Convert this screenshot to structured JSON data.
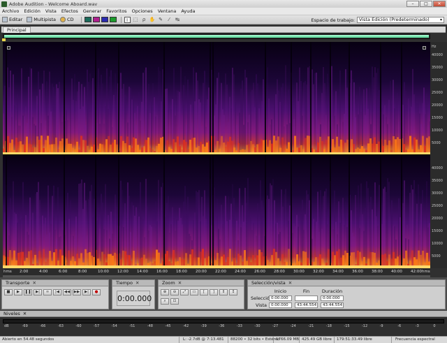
{
  "window": {
    "title": "Adobe Audition - Welcome Aboard.wav"
  },
  "menu": [
    "Archivo",
    "Edición",
    "Vista",
    "Efectos",
    "Generar",
    "Favoritos",
    "Opciones",
    "Ventana",
    "Ayuda"
  ],
  "toolbar": {
    "edit_label": "Editar",
    "multitrack_label": "Multipista",
    "cd_label": "CD",
    "workspace_label": "Espacio de trabajo:",
    "workspace_value": "Vista Edición (Predeterminado)"
  },
  "main_panel": {
    "tab": "Principal"
  },
  "spectrogram": {
    "hz_labels": [
      "Hz",
      "40000",
      "35000",
      "30000",
      "25000",
      "20000",
      "15000",
      "10000",
      "5000",
      "40000",
      "35000",
      "30000",
      "25000",
      "20000",
      "15000",
      "10000",
      "5000"
    ],
    "time_labels": [
      "hms",
      "2:00",
      "4:00",
      "6:00",
      "8:00",
      "10:00",
      "12:00",
      "14:00",
      "16:00",
      "18:00",
      "20:00",
      "22:00",
      "24:00",
      "26:00",
      "28:00",
      "30:00",
      "32:00",
      "34:00",
      "36:00",
      "38:00",
      "40:00",
      "42:00",
      "hms"
    ]
  },
  "transport": {
    "title": "Transporte"
  },
  "time": {
    "title": "Tiempo",
    "value": "0:00.000"
  },
  "zoom": {
    "title": "Zoom"
  },
  "selection": {
    "title": "Selección/vista",
    "headers": [
      "Inicio",
      "Fin",
      "Duración"
    ],
    "rows": [
      {
        "label": "Selección",
        "start": "0:00.000",
        "end": "",
        "duration": "0:00.000"
      },
      {
        "label": "Vista",
        "start": "0:00.000",
        "end": "43:44.554",
        "duration": "43:44.554"
      }
    ]
  },
  "levels": {
    "title": "Niveles",
    "scale": [
      "dB",
      "-69",
      "-66",
      "-63",
      "-60",
      "-57",
      "-54",
      "-51",
      "-48",
      "-45",
      "-42",
      "-39",
      "-36",
      "-33",
      "-30",
      "-27",
      "-24",
      "-21",
      "-18",
      "-15",
      "-12",
      "-9",
      "-6",
      "-3",
      "0"
    ]
  },
  "status": {
    "opened": "Abierto en 54.48 segundos",
    "level": "L: -2.7dB @",
    "position": "7:13.481",
    "format": "88200 • 32 bits • Estéreo",
    "size": "1766.09 MB",
    "free": "425.49 GB libre",
    "free_time": "179:51:33.49 libre",
    "view": "Frecuencia espectral"
  }
}
